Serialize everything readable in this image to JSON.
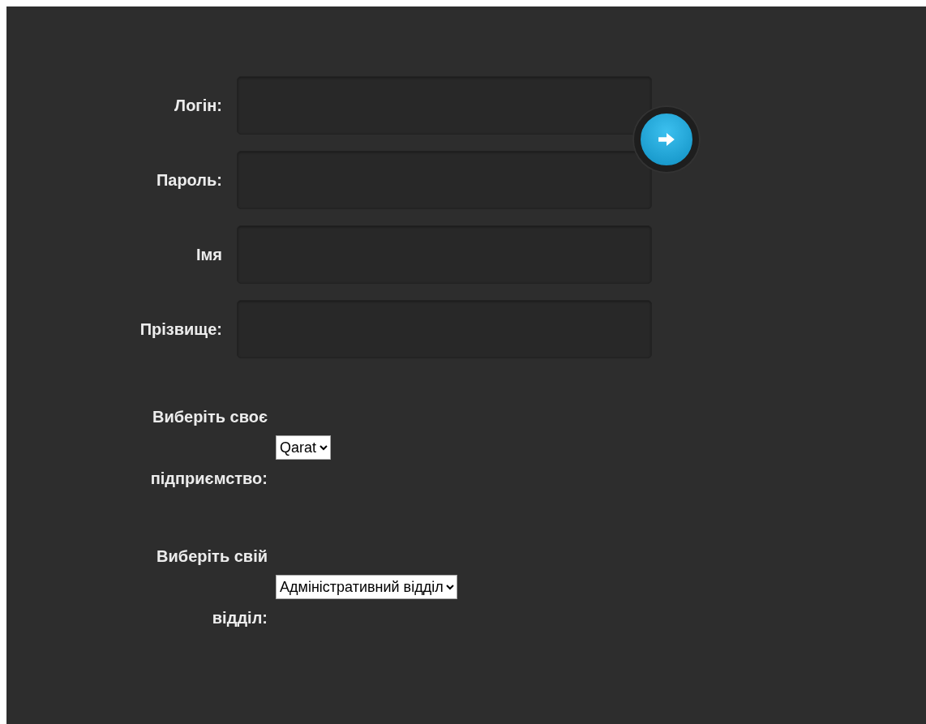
{
  "fields": [
    {
      "label": "Логін:"
    },
    {
      "label": "Пароль:"
    },
    {
      "label": "Імя"
    },
    {
      "label": "Прізвище:"
    }
  ],
  "selects": [
    {
      "label": "Виберіть своє підприємство:",
      "value": "Qarat"
    },
    {
      "label": "Виберіть свій відділ:",
      "value": "Адміністративний відділ"
    }
  ]
}
